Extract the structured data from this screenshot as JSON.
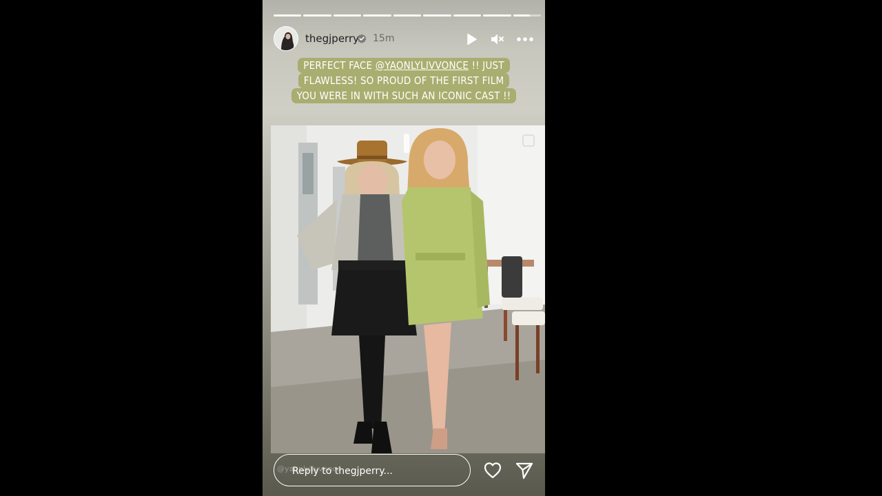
{
  "story": {
    "segment_count": 9,
    "username": "thegjperry",
    "time_ago": "15m",
    "caption_lines": [
      {
        "prefix": "PERFECT FACE ",
        "mention": "@YAONLYLIVVONCE",
        "suffix": " !! JUST"
      },
      {
        "text": "FLAWLESS! SO PROUD OF THE FIRST FILM"
      },
      {
        "text": "YOU WERE IN WITH SUCH AN ICONIC CAST !!"
      }
    ],
    "reply_placeholder": "Reply to thegjperry...",
    "watermark": "@yaonlylivvonce",
    "icons": [
      "verified-icon",
      "play-icon",
      "mute-icon",
      "more-icon",
      "heart-icon",
      "send-icon"
    ]
  }
}
